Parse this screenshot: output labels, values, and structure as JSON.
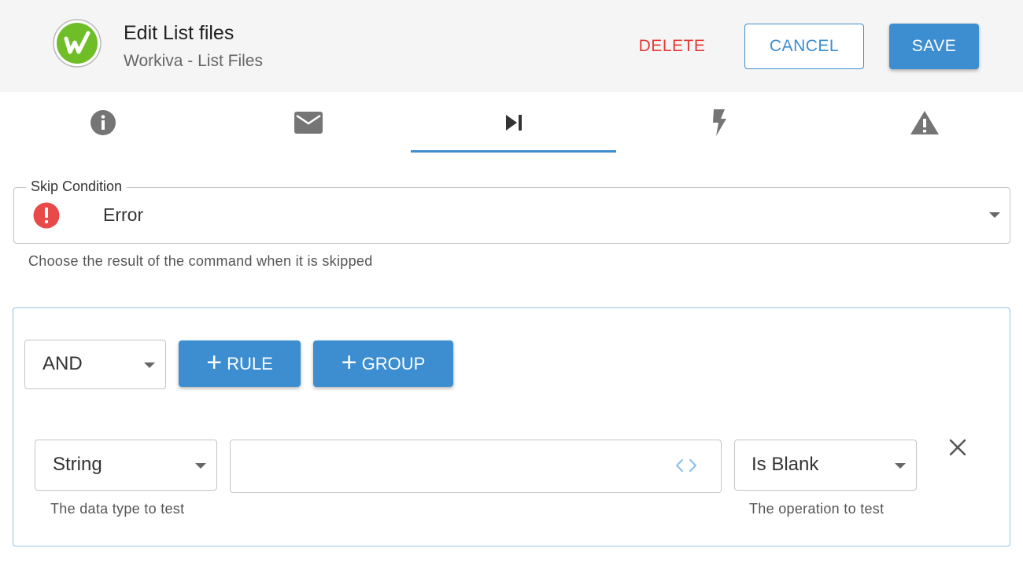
{
  "header": {
    "title": "Edit List files",
    "subtitle": "Workiva - List Files",
    "logo": "workiva-logo",
    "delete_label": "DELETE",
    "cancel_label": "CANCEL",
    "save_label": "SAVE"
  },
  "tabs": [
    {
      "icon": "info-icon",
      "selected": false
    },
    {
      "icon": "mail-icon",
      "selected": false
    },
    {
      "icon": "skip-next-icon",
      "selected": true
    },
    {
      "icon": "flash-icon",
      "selected": false
    },
    {
      "icon": "warning-icon",
      "selected": false
    }
  ],
  "skip_condition": {
    "label": "Skip Condition",
    "value": "Error",
    "icon": "error-icon",
    "help": "Choose the result of the command when it is skipped"
  },
  "query_builder": {
    "combinator": "AND",
    "add_rule_label": "RULE",
    "add_group_label": "GROUP",
    "rule": {
      "data_type": "String",
      "data_type_help": "The data type to test",
      "value": "",
      "operation": "Is Blank",
      "operation_help": "The operation to test"
    }
  },
  "colors": {
    "accent": "#3d8ed0",
    "danger": "#e53935",
    "logo_green": "#6fbe28"
  }
}
